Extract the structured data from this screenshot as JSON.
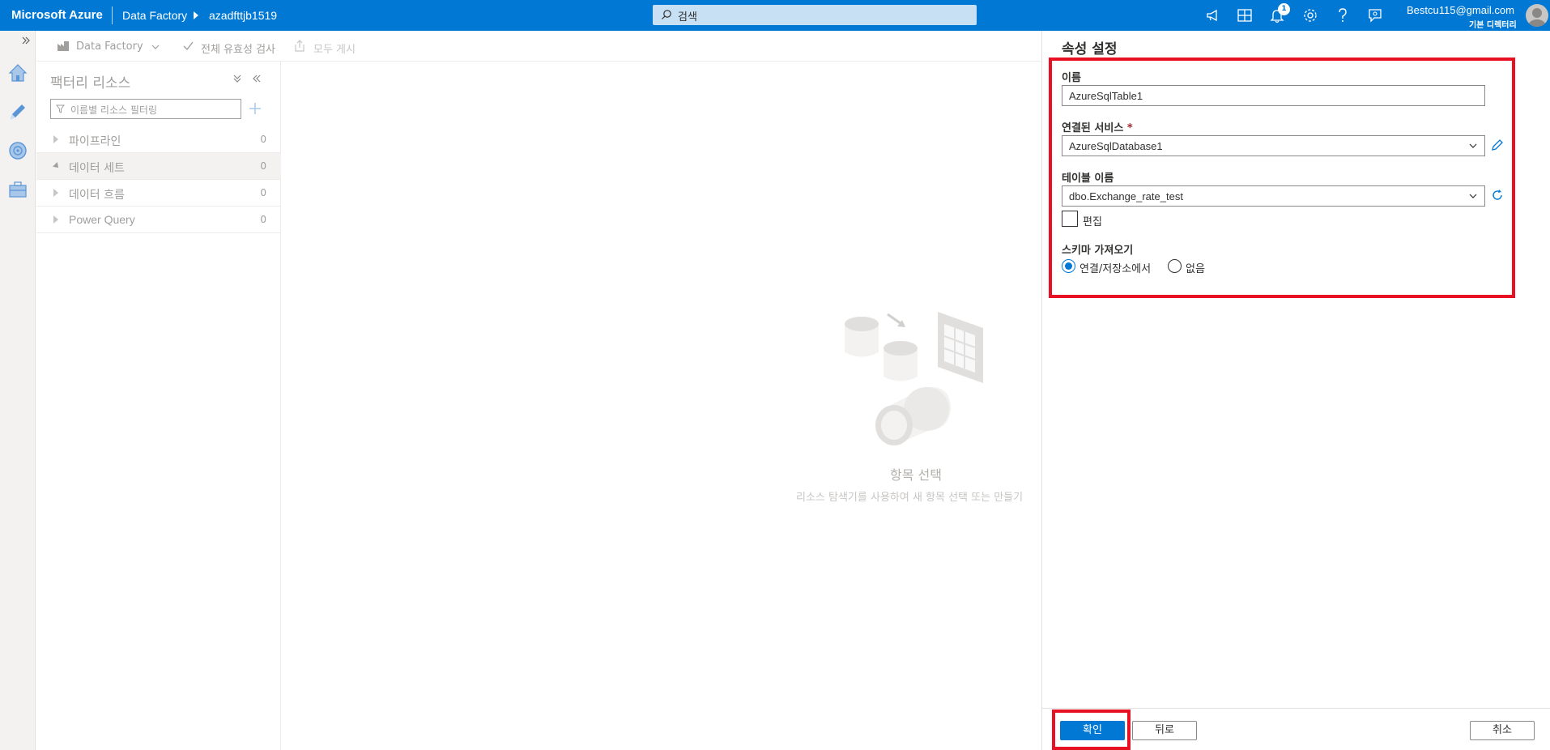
{
  "topbar": {
    "brand": "Microsoft Azure",
    "breadcrumb_service": "Data Factory",
    "breadcrumb_factory": "azadfttjb1519",
    "search_placeholder": "검색",
    "notification_count": "1",
    "user_email": "Bestcu115@gmail.com",
    "user_directory": "기본 디렉터리",
    "icons": [
      "megaphone-icon",
      "portal-switch-icon",
      "bell-icon",
      "gear-icon",
      "help-icon",
      "feedback-icon"
    ]
  },
  "rail": {
    "expand_icon": "double-chevron-right-icon",
    "items": [
      "home-icon",
      "pencil-author-icon",
      "monitor-icon",
      "toolbox-manage-icon"
    ]
  },
  "toolbar": {
    "factory_label": "Data Factory",
    "validate_label": "전체 유효성 검사",
    "publish_label": "모두 게시"
  },
  "resources": {
    "title": "팩터리 리소스",
    "filter_placeholder": "이름별 리소스 필터링",
    "rows": [
      {
        "label": "파이프라인",
        "count": "0"
      },
      {
        "label": "데이터 세트",
        "count": "0"
      },
      {
        "label": "데이터 흐름",
        "count": "0"
      },
      {
        "label": "Power Query",
        "count": "0"
      }
    ]
  },
  "empty_state": {
    "title": "항목 선택",
    "subtitle": "리소스 탐색기를 사용하여 새 항목 선택 또는 만들기"
  },
  "panel": {
    "title": "속성 설정",
    "name_label": "이름",
    "name_value": "AzureSqlTable1",
    "linked_service_label": "연결된 서비스",
    "required_mark": "*",
    "linked_service_value": "AzureSqlDatabase1",
    "table_label": "테이블 이름",
    "table_value": "dbo.Exchange_rate_test",
    "edit_label": "편집",
    "edit_checked": false,
    "schema_label": "스키마 가져오기",
    "schema_options": [
      "연결/저장소에서",
      "없음"
    ],
    "schema_selected": "연결/저장소에서",
    "ok_button": "확인",
    "back_button": "뒤로",
    "cancel_button": "취소",
    "highlight_color": "#e81123",
    "accent_color": "#0078d4"
  }
}
